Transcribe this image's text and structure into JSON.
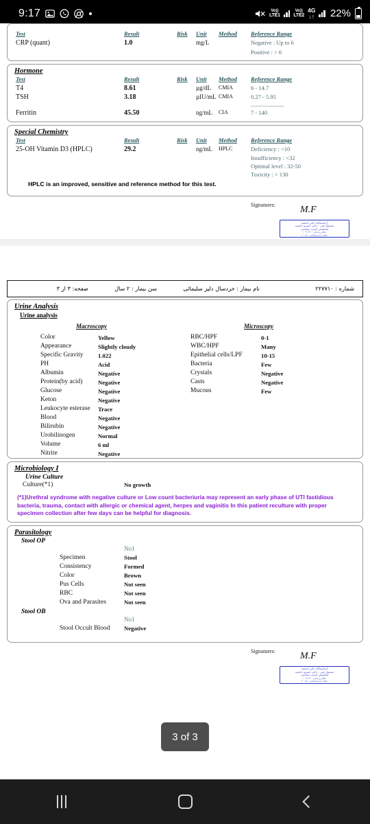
{
  "statusbar": {
    "clock": "9:17",
    "left_icons": [
      "photos-icon",
      "whatsapp-icon",
      "chrome-icon",
      "dot-icon"
    ],
    "mute_icon": "mute-icon",
    "sim1_volte": "Vo))",
    "sim1_label": "LTE1",
    "sim2_volte": "Vo))",
    "sim2_label": "LTE2",
    "network_4g": "4G",
    "network_arrows": "↓↑",
    "battery_pct": "22%"
  },
  "columns": {
    "test": "Test",
    "result": "Result",
    "risk": "Risk",
    "unit": "Unit",
    "method": "Method",
    "reference_range": "Reference Range"
  },
  "page1": {
    "crp_card": {
      "rows": [
        {
          "test": "CRP (quant)",
          "result": "1.0",
          "risk": "",
          "unit": "mg/L",
          "method": "",
          "ref_lines": [
            "Negative :  Up to 6",
            "Positive :    > 6"
          ]
        }
      ]
    },
    "hormone_card": {
      "title": "Hormone",
      "rows": [
        {
          "test": "T4",
          "result": "8.61",
          "risk": "",
          "unit": "µg/dL",
          "method": "CMIA",
          "ref_lines": [
            "6 - 14.7"
          ]
        },
        {
          "test": "TSH",
          "result": "3.18",
          "risk": "",
          "unit": "µIU/mL",
          "method": "CMIA",
          "ref_lines": [
            "0.27 - 5.95"
          ],
          "dash_after": "---------------"
        },
        {
          "test": "Ferritin",
          "result": "45.50",
          "risk": "",
          "unit": "ng/mL",
          "method": "CIA",
          "ref_lines": [
            "7 - 140"
          ]
        }
      ]
    },
    "special_chem_card": {
      "title": "Special Chemistry",
      "rows": [
        {
          "test": "25-OH Vitamin D3 (HPLC)",
          "result": "29.2",
          "risk": "",
          "unit": "ng/mL",
          "method": "HPLC",
          "ref_lines": [
            "Deficiency : <10",
            "Insufficiency : <32",
            "Optimal level : 32-50",
            "Toxicity : > 130"
          ]
        }
      ],
      "note": "HPLC is an improved, sensitive and reference method for this test."
    },
    "signature": {
      "label": "Signatures:",
      "name": "M.F",
      "stamp_lines": [
        "آزمایشگاه دکتر دانشید",
        "مسئول فنی : دکتر خسرو دانشید",
        "متخصص آسیب شناسی",
        "نظام پزشکی : ۱۰۹۱۲۳",
        "نظام آزمایشگاهی : ۲۰۱۵"
      ]
    }
  },
  "page2": {
    "header": {
      "number": "شماره : ۲۲۷۷۱۰",
      "patient_name": "نام بیمار : خردسال دلیز سلیمائی",
      "age": "سن بیمار :     ۲ سال",
      "page": "صفحه:   ۳  از   ۳"
    },
    "urine_analysis": {
      "title": "Urine Analysis",
      "subtitle": "Urine analysis",
      "macroscopy_header": "Macroscopy",
      "microscopy_header": "Microscopy",
      "macroscopy": [
        {
          "label": "Color",
          "value": "Yellow"
        },
        {
          "label": "Appearance",
          "value": "Slightly cloudy"
        },
        {
          "label": "Specific Gravity",
          "value": "1.022"
        },
        {
          "label": "PH",
          "value": "Acid"
        },
        {
          "label": "Albumin",
          "value": "Negative"
        },
        {
          "label": "Protein(by acid)",
          "value": "Negative"
        },
        {
          "label": "Glucose",
          "value": "Negative"
        },
        {
          "label": "Keton",
          "value": "Negative"
        },
        {
          "label": "Leukocyte esterase",
          "value": "Trace"
        },
        {
          "label": "Blood",
          "value": "Negative"
        },
        {
          "label": "Bilirubin",
          "value": "Negative"
        },
        {
          "label": "Urobilinogen",
          "value": "Normal"
        },
        {
          "label": "Volume",
          "value": "6 ml"
        },
        {
          "label": "Nitrite",
          "value": "Negative"
        }
      ],
      "microscopy": [
        {
          "label": "RBC/HPF",
          "value": "0-1"
        },
        {
          "label": "WBC/HPF",
          "value": "Many"
        },
        {
          "label": "Epithelial cells/LPF",
          "value": "10-15"
        },
        {
          "label": "Bacteria",
          "value": "Few"
        },
        {
          "label": "Crystals",
          "value": "Negative"
        },
        {
          "label": "Casts",
          "value": "Negative"
        },
        {
          "label": "Mucous",
          "value": "Few"
        }
      ]
    },
    "microbiology": {
      "title": "Microbiology I",
      "subtitle": "Urine Culture",
      "rows": [
        {
          "label": "Culture(*1)",
          "value": "No growth"
        }
      ],
      "note": "(*1)Urethral syndrome with negative culture or Low count bacteriuria may represent an early phase of UTI fastidious bacteria, trauma, contact with allergic or chemical agent, herpes and vaginitis In this patient reculture with proper specimen collection after few days can be helpful for diagnosis."
    },
    "parasitology": {
      "title": "Parasitology",
      "stool_op": {
        "subtitle": "Stool OP",
        "col_header": "No1",
        "rows": [
          {
            "label": "Specimen",
            "value": "Stool"
          },
          {
            "label": "Consistency",
            "value": "Formed"
          },
          {
            "label": "Color",
            "value": "Brown"
          },
          {
            "label": "Pus Cells",
            "value": "Not seen"
          },
          {
            "label": "RBC",
            "value": "Not seen"
          },
          {
            "label": "Ova and Parasites",
            "value": "Not seen"
          }
        ]
      },
      "stool_ob": {
        "subtitle": "Stool OB",
        "col_header": "No1",
        "rows": [
          {
            "label": "Stool Occult Blood",
            "value": "Negative"
          }
        ]
      }
    },
    "signature": {
      "label": "Signatures:",
      "name": "M.F",
      "stamp_lines": [
        "آزمایشگاه دکتر دانشید",
        "مسئول فنی : دکتر خسرو دانشید",
        "متخصص آسیب شناسی",
        "نظام پزشکی : ۱۰۹۱۲۳",
        "نظام آزمایشگاهی : ۲۰۱۵"
      ]
    }
  },
  "page_indicator": "3 of 3",
  "navbar": {
    "recents": "recents-icon",
    "home": "home-icon",
    "back": "back-icon"
  }
}
